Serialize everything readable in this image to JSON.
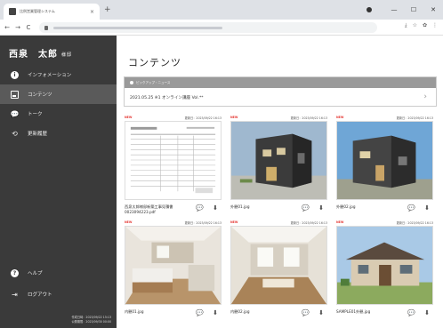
{
  "browser": {
    "tab_title": "比例営業管理システム",
    "tab_close": "×",
    "new_tab": "+",
    "window_controls": [
      "—",
      "☐",
      "✕"
    ],
    "nav_buttons": [
      "←",
      "→",
      "C",
      "⌂"
    ],
    "toolbar_icons": [
      "⤓",
      "☆",
      "✿",
      "⋮"
    ]
  },
  "sidebar": {
    "user_name": "西泉　太郎",
    "honorific": "様邸",
    "items": [
      {
        "label": "インフォメーション",
        "icon": "info-icon",
        "glyph": "i"
      },
      {
        "label": "コンテンツ",
        "icon": "image-icon",
        "glyph": ""
      },
      {
        "label": "トーク",
        "icon": "chat-icon",
        "glyph": "💬"
      },
      {
        "label": "更新履歴",
        "icon": "history-icon",
        "glyph": "⟲"
      }
    ],
    "bottom_items": [
      {
        "label": "ヘルプ",
        "icon": "help-icon",
        "glyph": "?"
      },
      {
        "label": "ログアウト",
        "icon": "logout-icon",
        "glyph": "⇥"
      }
    ],
    "timestamps": [
      "作成日時：2023/09/22 15:13",
      "公開期限：2023/09/30 00:00"
    ]
  },
  "main": {
    "title": "コンテンツ",
    "notice": {
      "header": "ピックアップ・ニュース",
      "text": "2021.05.25 ※1 オンライン講座 Vol.**",
      "chevron": "›"
    },
    "cards": [
      {
        "new": "NEW",
        "updated": "更新日：2023/09/22 16:13",
        "filename": "西泉太郎様邸新築工事見積書0023094223.pdf",
        "thumb": "document"
      },
      {
        "new": "NEW",
        "updated": "更新日：2023/09/22 16:13",
        "filename": "外観01.jpg",
        "thumb": "exterior-dark"
      },
      {
        "new": "NEW",
        "updated": "更新日：2023/09/22 16:13",
        "filename": "外観02.jpg",
        "thumb": "exterior-sky"
      },
      {
        "new": "NEW",
        "updated": "更新日：2023/09/22 16:13",
        "filename": "内観01.jpg",
        "thumb": "interior-kitchen"
      },
      {
        "new": "NEW",
        "updated": "更新日：2023/09/22 16:13",
        "filename": "内観02.jpg",
        "thumb": "interior-room"
      },
      {
        "new": "NEW",
        "updated": "更新日：2023/09/22 16:13",
        "filename": "SAMPLE01外観.jpg",
        "thumb": "exterior-house"
      }
    ],
    "card_actions": {
      "comment": "💬",
      "download": "⬇"
    }
  }
}
